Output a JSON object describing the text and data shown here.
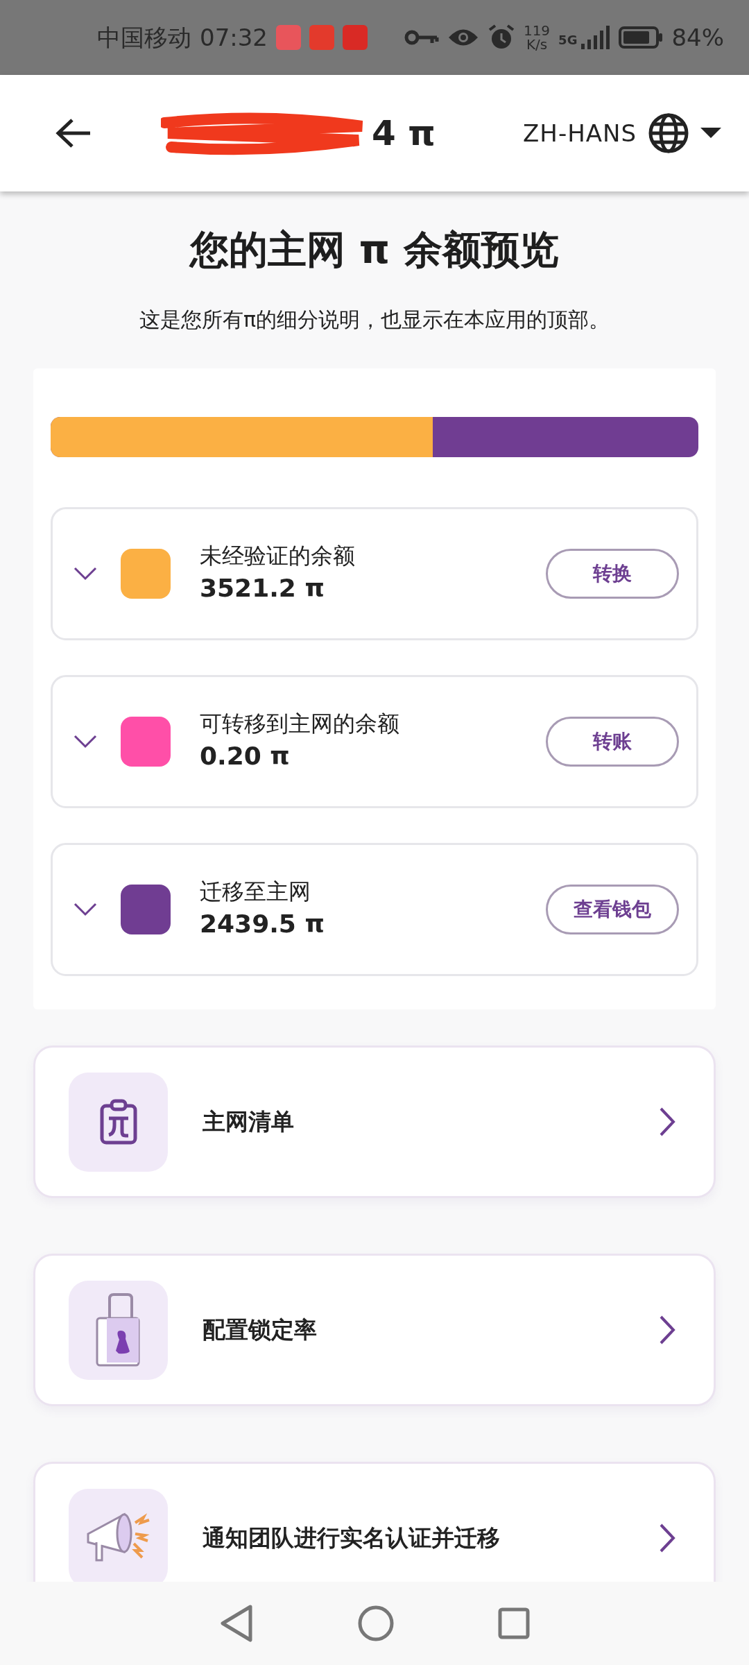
{
  "status_bar": {
    "carrier": "中国移动",
    "time": "07:32",
    "speed_value": "119",
    "speed_unit": "K/s",
    "network": "5G",
    "battery_percent": "84%"
  },
  "header": {
    "title_visible": "4 π",
    "language": "ZH-HANS"
  },
  "page": {
    "title": "您的主网 π 余额预览",
    "subtitle": "这是您所有π的细分说明，也显示在本应用的顶部。"
  },
  "balance_bar": {
    "level": 0.59
  },
  "balances": [
    {
      "label": "未经验证的余额",
      "amount": "3521.2 π",
      "color": "#fbb044",
      "button": "转换",
      "expanded": false
    },
    {
      "label": "可转移到主网的余额",
      "amount": "0.20 π",
      "color": "#ff4fa8",
      "button": "转账",
      "expanded": false
    },
    {
      "label": "迁移至主网",
      "amount": "2439.5 π",
      "color": "#703d92",
      "button": "查看钱包",
      "expanded": false
    }
  ],
  "menu": [
    {
      "kind": "checklist",
      "label": "主网清单"
    },
    {
      "kind": "lock",
      "label": "配置锁定率"
    },
    {
      "kind": "megaphone",
      "label": "通知团队进行实名认证并迁移"
    }
  ]
}
